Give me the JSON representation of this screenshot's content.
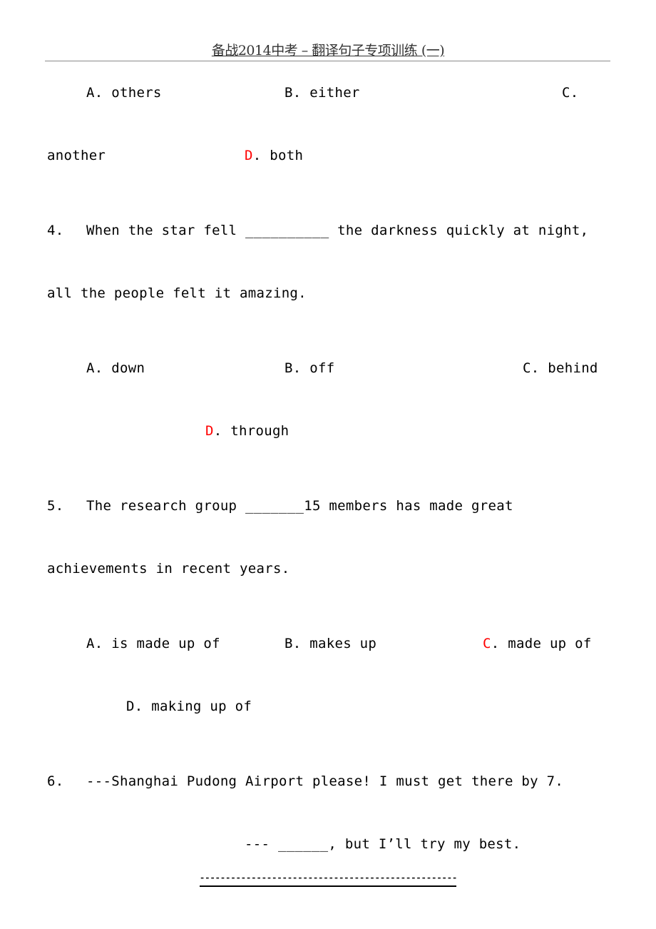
{
  "header": {
    "title": "备战2014中考 – 翻译句子专项训练 (一)"
  },
  "accent_color": "#ff0000",
  "q3_options": {
    "a_label": "A.",
    "a_text": "others",
    "b_label": "B.",
    "b_text": "either",
    "c_label": "C.",
    "c_text": "another",
    "d_label": "D.",
    "d_text": "both",
    "answer": "D"
  },
  "q4": {
    "number": "4.",
    "line1": "When the star fell __________ the darkness quickly at night,",
    "line2": "all the people felt it amazing.",
    "options": {
      "a_label": "A.",
      "a_text": "down",
      "b_label": "B.",
      "b_text": "off",
      "c_label": "C.",
      "c_text": "behind",
      "d_label": "D.",
      "d_text": "through"
    },
    "answer": "D"
  },
  "q5": {
    "number": "5.",
    "line1": "The research group _______15 members has made great",
    "line2": "achievements in recent years.",
    "options": {
      "a_label": "A.",
      "a_text": "is made up of",
      "b_label": "B.",
      "b_text": "makes up",
      "c_label": "C.",
      "c_text": "made up of",
      "d_label": "D.",
      "d_text": "making up of"
    },
    "answer": "C"
  },
  "q6": {
    "number": "6.",
    "line1": "---Shanghai Pudong Airport please! I must get there by 7.",
    "line2": "--- ______, but I’ll try my best."
  },
  "footer": {
    "dashes": "-----------------------------------------------------"
  }
}
